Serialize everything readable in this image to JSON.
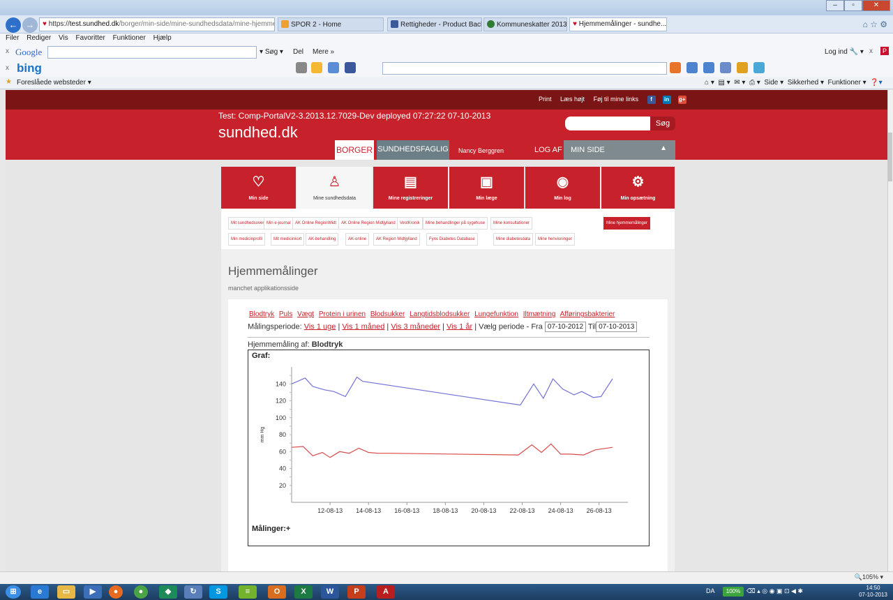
{
  "browser": {
    "address": {
      "scheme": "https://",
      "host": "test.sundhed.dk",
      "path": "/borger/min-side/mine-sundhedsdata/mine-hjemme-maalin"
    },
    "tabs": [
      {
        "label": "SPOR 2 - Home",
        "color": "#f0a030"
      },
      {
        "label": "Rettigheder - Product Backlog ...",
        "color": "#3b5998"
      },
      {
        "label": "Kommuneskatter 2013",
        "color": "#2e7d32"
      },
      {
        "label": "Hjemmemålinger - sundhe...",
        "color": "#c8102e"
      }
    ],
    "close_tab": "×",
    "menu": [
      "Filer",
      "Rediger",
      "Vis",
      "Favoritter",
      "Funktioner",
      "Hjælp"
    ],
    "google": {
      "logo": "Google",
      "sog": "Søg",
      "del": "Del",
      "mere": "Mere »",
      "login": "Log ind"
    },
    "bing": {
      "logo": "bing"
    },
    "favorites": {
      "label": "Foreslåede websteder"
    },
    "commandbar": [
      "Side",
      "Sikkerhed",
      "Funktioner"
    ]
  },
  "site": {
    "toplinks": [
      "Print",
      "Læs højt",
      "Føj til mine links"
    ],
    "deploy": "Test: Comp-PortalV2-3.2013.12.7029-Dev deployed 07:27:22 07-10-2013",
    "logo": "sundhed.dk",
    "search_button": "Søg",
    "borger": "BORGER",
    "sundhedsfaglig": "SUNDHEDSFAGLIG",
    "user": "Nancy Berggren",
    "logaf": "LOG AF",
    "minside": "MIN SIDE"
  },
  "main_tabs": [
    {
      "label": "Min side",
      "icon": "person-heart-icon"
    },
    {
      "label": "Mine sundhedsdata",
      "icon": "person-data-icon"
    },
    {
      "label": "Mine registreringer",
      "icon": "registry-icon"
    },
    {
      "label": "Min læge",
      "icon": "doctor-card-icon"
    },
    {
      "label": "Min log",
      "icon": "eye-icon"
    },
    {
      "label": "Min opsætning",
      "icon": "gears-icon"
    }
  ],
  "subnav_row1": [
    "Mit sundhedsoverblik",
    "Min e-journal",
    "AK Online RegionMidt",
    "AK Online Region Midtjylland",
    "VestKronik",
    "Mine behandlinger på sygehuse",
    "Mine konsultationer",
    "Mine hjemmemålinger"
  ],
  "subnav_row2": [
    "Min medicinprofil",
    "Mit medicinkort",
    "AK-behandling",
    "AK-online",
    "AK Region Midtjylland",
    "Fyns Diabetes Database",
    "Mine diabetesdata",
    "Mine henvisninger"
  ],
  "page": {
    "title": "Hjemmemålinger",
    "subtitle": "manchet applikationsside",
    "categories": [
      "Blodtryk",
      "Puls",
      "Vægt",
      "Protein i urinen",
      "Blodsukker",
      "Langtidsblodsukker",
      "Lungefunktion",
      "Iltmætning",
      "Afføringsbakterier"
    ],
    "period_label": "Målingsperiode:",
    "period_links": [
      "Vis 1 uge",
      "Vis 1 måned",
      "Vis 3 måneder",
      "Vis 1 år"
    ],
    "sep": "|",
    "choose_period": "Vælg periode",
    "fra": "- Fra",
    "fra_value": "07-10-2012",
    "til": "Til",
    "til_value": "07-10-2013",
    "measurement_prefix": "Hjemmemåling af:",
    "measurement_name": "Blodtryk",
    "graf": "Graf:",
    "maalinger": "Målinger:+"
  },
  "chart_data": {
    "type": "line",
    "ylabel": "mm Hg",
    "ylim": [
      0,
      160
    ],
    "yticks": [
      20,
      40,
      60,
      80,
      100,
      120,
      140
    ],
    "xlim": [
      10,
      27.5
    ],
    "xticks": [
      {
        "v": 12,
        "label": "12-08-13"
      },
      {
        "v": 14,
        "label": "14-08-13"
      },
      {
        "v": 16,
        "label": "16-08-13"
      },
      {
        "v": 18,
        "label": "18-08-13"
      },
      {
        "v": 20,
        "label": "20-08-13"
      },
      {
        "v": 22,
        "label": "22-08-13"
      },
      {
        "v": 24,
        "label": "24-08-13"
      },
      {
        "v": 26,
        "label": "26-08-13"
      }
    ],
    "grid": false,
    "series": [
      {
        "color": "#7070d8",
        "x": [
          10,
          10.7,
          11.1,
          11.7,
          12.2,
          12.8,
          13.4,
          13.7,
          21.9,
          22.6,
          23.1,
          23.6,
          24.1,
          24.7,
          25.1,
          25.7,
          26.1,
          26.7
        ],
        "y": [
          140,
          147,
          137,
          133,
          131,
          125,
          148,
          143,
          115,
          140,
          123,
          146,
          134,
          127,
          131,
          124,
          125,
          146
        ]
      },
      {
        "color": "#d84a4a",
        "x": [
          10,
          10.6,
          11.1,
          11.6,
          12,
          12.5,
          13,
          13.5,
          14,
          14.5,
          15.2,
          21.8,
          22.5,
          23,
          23.5,
          24,
          24.5,
          25.2,
          25.8,
          26.7
        ],
        "y": [
          65,
          66,
          55,
          59,
          53,
          60,
          58,
          64,
          59,
          58,
          58,
          56,
          68,
          59,
          69,
          57,
          57,
          56,
          62,
          65
        ]
      }
    ]
  }
}
